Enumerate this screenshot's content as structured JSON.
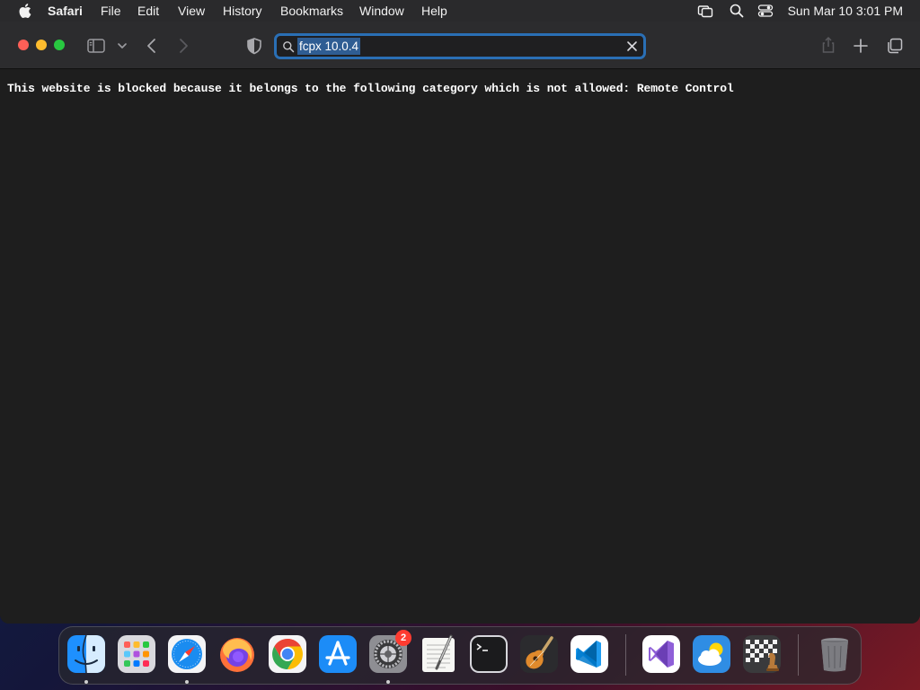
{
  "menubar": {
    "app_name": "Safari",
    "items": [
      "File",
      "Edit",
      "View",
      "History",
      "Bookmarks",
      "Window",
      "Help"
    ],
    "clock": "Sun Mar 10  3:01 PM"
  },
  "toolbar": {
    "address": "fcpx 10.0.4"
  },
  "page": {
    "message": "This website is blocked because it belongs to the following category which is not allowed: Remote Control"
  },
  "dock": {
    "apps": [
      {
        "name": "Finder",
        "icon": "finder-icon",
        "running": true
      },
      {
        "name": "Launchpad",
        "icon": "launchpad-icon",
        "running": false
      },
      {
        "name": "Safari",
        "icon": "safari-icon",
        "running": true
      },
      {
        "name": "Firefox",
        "icon": "firefox-icon",
        "running": false
      },
      {
        "name": "Google Chrome",
        "icon": "chrome-icon",
        "running": false
      },
      {
        "name": "App Store",
        "icon": "app-store-icon",
        "running": false
      },
      {
        "name": "System Settings",
        "icon": "system-settings-icon",
        "running": true,
        "badge": "2"
      },
      {
        "name": "TextEdit",
        "icon": "textedit-icon",
        "running": false
      },
      {
        "name": "Terminal",
        "icon": "terminal-icon",
        "running": false
      },
      {
        "name": "GarageBand",
        "icon": "garageband-icon",
        "running": false
      },
      {
        "name": "Visual Studio Code",
        "icon": "vscode-icon",
        "running": false
      },
      {
        "name": "Visual Studio",
        "icon": "visual-studio-icon",
        "running": false
      },
      {
        "name": "Weather",
        "icon": "weather-icon",
        "running": false
      },
      {
        "name": "Chess",
        "icon": "chess-icon",
        "running": false
      },
      {
        "name": "Trash",
        "icon": "trash-icon",
        "running": false
      }
    ]
  },
  "colors": {
    "accent": "#2a6fb5",
    "close": "#ff5f57",
    "minimize": "#febc2e",
    "zoom": "#28c840",
    "badge": "#ff3b30"
  }
}
